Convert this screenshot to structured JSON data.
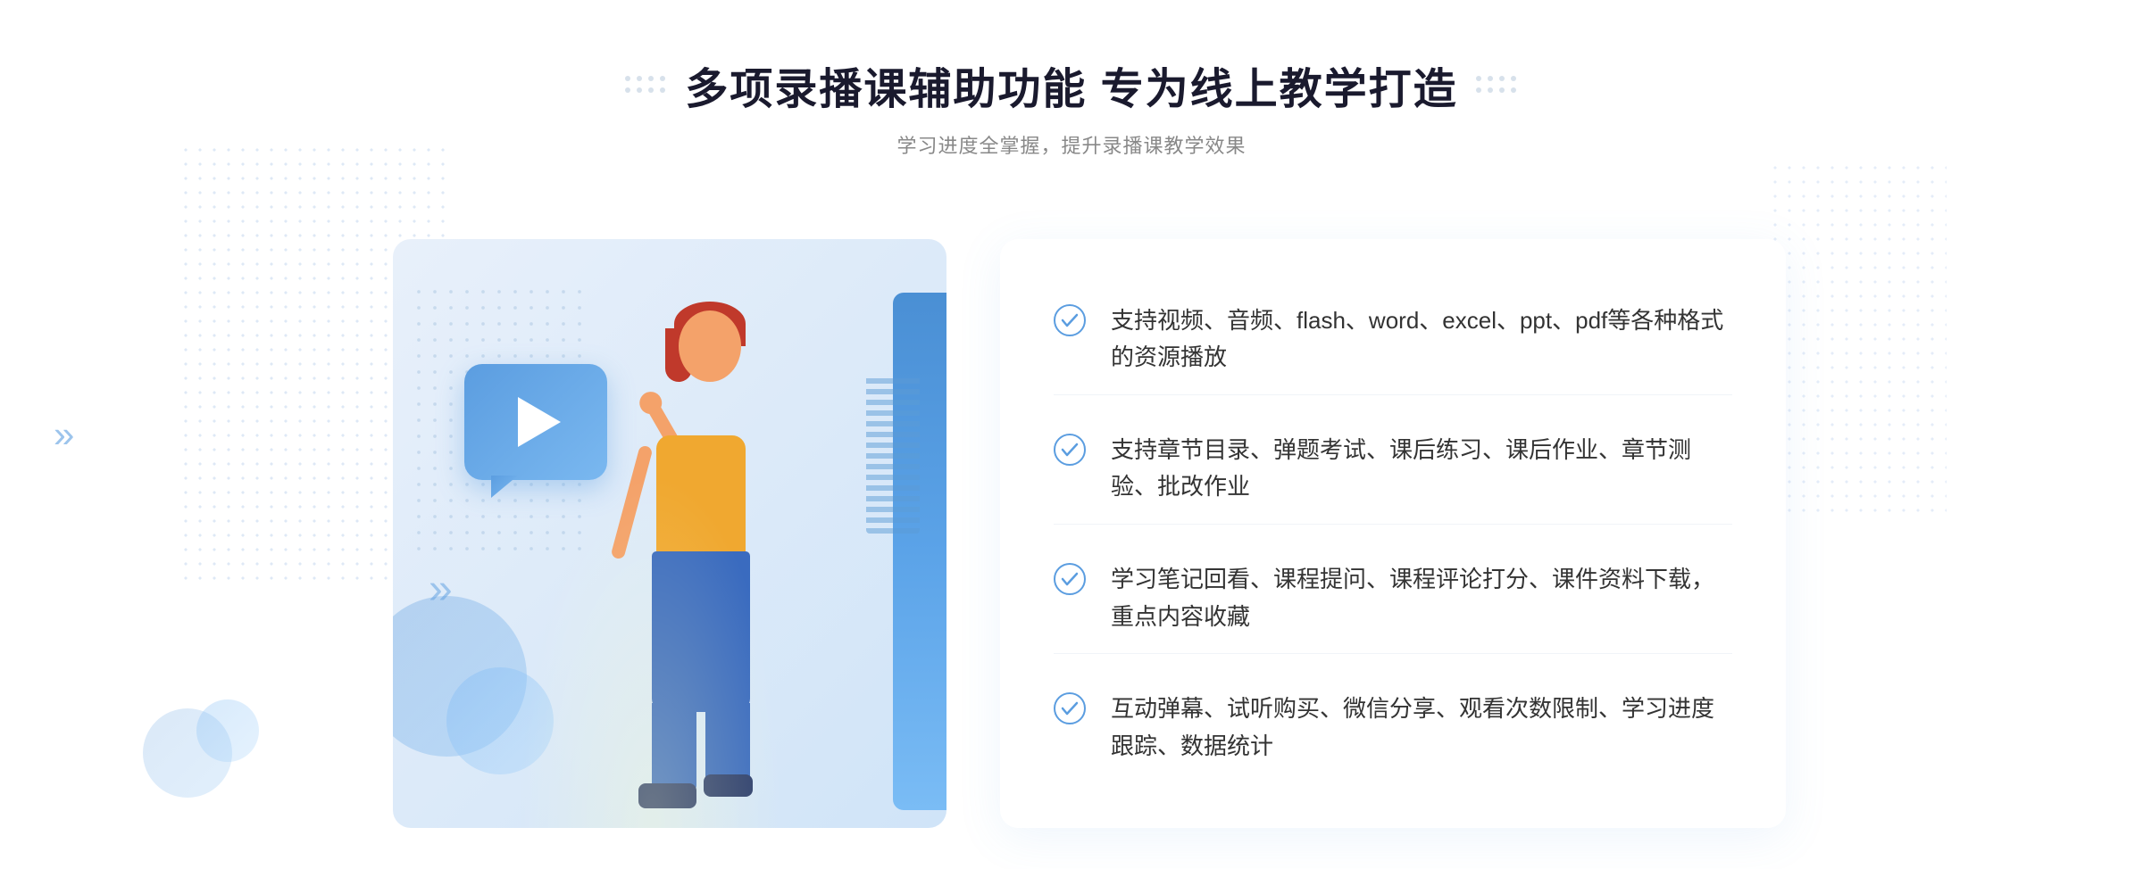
{
  "page": {
    "background": "#ffffff"
  },
  "header": {
    "main_title": "多项录播课辅助功能 专为线上教学打造",
    "sub_title": "学习进度全掌握，提升录播课教学效果"
  },
  "features": [
    {
      "id": 1,
      "text": "支持视频、音频、flash、word、excel、ppt、pdf等各种格式的资源播放"
    },
    {
      "id": 2,
      "text": "支持章节目录、弹题考试、课后练习、课后作业、章节测验、批改作业"
    },
    {
      "id": 3,
      "text": "学习笔记回看、课程提问、课程评论打分、课件资料下载，重点内容收藏"
    },
    {
      "id": 4,
      "text": "互动弹幕、试听购买、微信分享、观看次数限制、学习进度跟踪、数据统计"
    }
  ],
  "colors": {
    "accent_blue": "#4a90d9",
    "check_blue": "#5b9de0",
    "title_dark": "#1a1a2e",
    "text_gray": "#333333",
    "sub_gray": "#888888"
  },
  "icons": {
    "play": "▶",
    "chevron": "»",
    "check": "✓"
  }
}
